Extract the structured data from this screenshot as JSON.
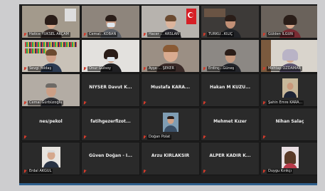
{
  "participants": [
    {
      "name": "Hatice YÜKSEL AKÇAM",
      "type": "video",
      "muted": true
    },
    {
      "name": "Cemal...KOBAN",
      "type": "video",
      "muted": true
    },
    {
      "name": "Hacer ... ARSLAN",
      "type": "video",
      "muted": true
    },
    {
      "name": "TÜRKÜ...KILIÇ",
      "type": "video",
      "muted": true
    },
    {
      "name": "Gülden İLGÜN",
      "type": "video",
      "muted": true
    },
    {
      "name": "Sevgi Yoldaş",
      "type": "video",
      "muted": true
    },
    {
      "name": "Onur Gülsoy",
      "type": "video",
      "muted": true
    },
    {
      "name": "Ayşe ... ŞEKER",
      "type": "video",
      "muted": true
    },
    {
      "name": "Erdinç...Güneş",
      "type": "video",
      "muted": true
    },
    {
      "name": "Mehtap ÖZDAMAR",
      "type": "video",
      "muted": true
    },
    {
      "name": "Cemal Gürbüzoğlu",
      "type": "video",
      "muted": true
    },
    {
      "name": "NİYSER Davut K...",
      "type": "name",
      "muted": true
    },
    {
      "name": "Mustafa KARA...",
      "type": "name",
      "muted": true
    },
    {
      "name": "Hakan M KUZU...",
      "type": "name",
      "muted": true
    },
    {
      "name": "Şahin Emre KARA...",
      "type": "photo",
      "muted": true
    },
    {
      "name": "nes/pekol",
      "type": "name",
      "muted": true
    },
    {
      "name": "fatihgezerfizot...",
      "type": "name",
      "muted": true
    },
    {
      "name": "Doğan Polat",
      "type": "photo",
      "muted": true
    },
    {
      "name": "Mehmet Kızer",
      "type": "name",
      "muted": true
    },
    {
      "name": "Nihan Salaç",
      "type": "name",
      "muted": true
    },
    {
      "name": "Erdal AKGÜL",
      "type": "photo",
      "muted": true
    },
    {
      "name": "Güven Doğan - İ...",
      "type": "name",
      "muted": true
    },
    {
      "name": "Arzu KIRLAKSIR",
      "type": "name",
      "muted": true
    },
    {
      "name": "ALPER KADİR K...",
      "type": "name",
      "muted": true
    },
    {
      "name": "Duygu Kırıkçı",
      "type": "photo",
      "muted": true
    }
  ]
}
